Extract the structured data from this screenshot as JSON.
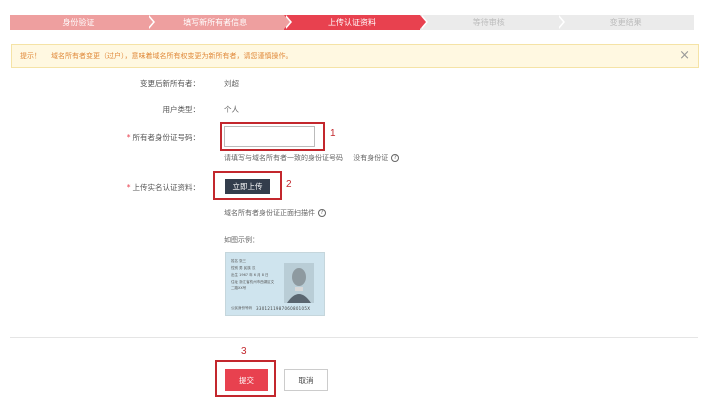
{
  "steps": [
    {
      "label": "身份验证",
      "state": "done"
    },
    {
      "label": "填写新所有者信息",
      "state": "done"
    },
    {
      "label": "上传认证资料",
      "state": "current"
    },
    {
      "label": "等待审核",
      "state": "todo"
    },
    {
      "label": "变更结果",
      "state": "todo"
    }
  ],
  "notice": {
    "prefix": "提示！",
    "message": "域名所有者变更（过户），意味着域名所有权变更为新所有者，请您谨慎操作。",
    "close_glyph": "×"
  },
  "form": {
    "new_owner_label": "变更后新所有者：",
    "new_owner_value": "刘超",
    "user_type_label": "用户类型：",
    "user_type_value": "个人",
    "id_number_label": "所有者身份证号码：",
    "id_number_value": "",
    "id_hint": "请填写与域名所有者一致的身份证号码",
    "no_id_link": "没有身份证",
    "upload_label": "上传实名认证资料：",
    "upload_button": "立即上传",
    "scan_hint": "域名所有者身份证正面扫描件",
    "example_label": "如图示例：",
    "required_mark": "*",
    "help_glyph": "?"
  },
  "card": {
    "line1": "姓名  张三",
    "line2": "性别  男   民族  汉",
    "line3": "出生  1967 年 6 月 8 日",
    "line4": "住址  浙江省杭州市西湖区文",
    "line5": "二路XX号",
    "id_label": "公民身份号码",
    "id_number": "330121198706080105X"
  },
  "annotations": {
    "one": "1",
    "two": "2",
    "three": "3"
  },
  "actions": {
    "submit": "提交",
    "cancel": "取消"
  },
  "colors": {
    "accent": "#e8414f",
    "done": "#ee9f9f",
    "todo": "#ebebeb",
    "annotation": "#c3272d",
    "notice_bg": "#fff8e1"
  }
}
